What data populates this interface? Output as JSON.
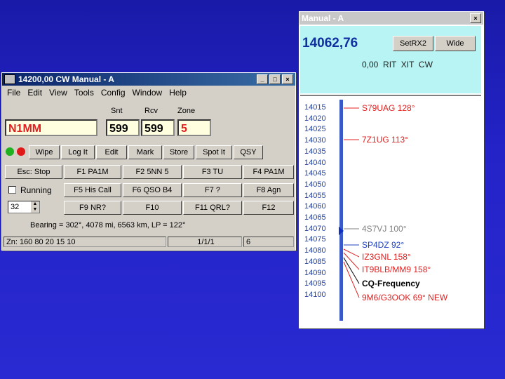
{
  "main": {
    "title": "14200,00 CW Manual - A",
    "window_controls": [
      "_",
      "□",
      "×"
    ],
    "menu": [
      "File",
      "Edit",
      "View",
      "Tools",
      "Config",
      "Window",
      "Help"
    ],
    "labels": {
      "snt": "Snt",
      "rcv": "Rcv",
      "zone": "Zone"
    },
    "callsign": "N1MM",
    "snt": "599",
    "rcv": "599",
    "zone": "5",
    "action_buttons": [
      "Wipe",
      "Log It",
      "Edit",
      "Mark",
      "Store",
      "Spot It",
      "QSY"
    ],
    "fkeys": [
      "Esc: Stop",
      "F1 PA1M",
      "F2 5NN 5",
      "F3 TU",
      "F4 PA1M",
      "F5 His Call",
      "F6 QSO B4",
      "F7 ?",
      "F8 Agn",
      "F9 NR?",
      "F10",
      "F11 QRL?",
      "F12"
    ],
    "running_label": "Running",
    "spin_value": "32",
    "bearing": "Bearing = 302°, 4078 mi, 6563 km, LP = 122°",
    "status": [
      "Zn: 160 80 20 15 10",
      "1/1/1",
      "6"
    ]
  },
  "bandmap": {
    "title": "Manual - A",
    "close": "×",
    "frequency": "14062,76",
    "buttons": [
      "SetRX2",
      "Wide"
    ],
    "indicators": "0,00  RIT  XIT  CW",
    "scale": [
      "14015",
      "14020",
      "14025",
      "14030",
      "14035",
      "14040",
      "14045",
      "14050",
      "14055",
      "14060",
      "14065",
      "14070",
      "14075",
      "14080",
      "14085",
      "14090",
      "14095",
      "14100"
    ],
    "spots": [
      {
        "text": "S79UAG 128°",
        "color": "#e02020"
      },
      {
        "text": "7Z1UG 113°",
        "color": "#e02020"
      },
      {
        "text": "4S7VJ 100°",
        "color": "#808080"
      },
      {
        "text": "SP4DZ 92°",
        "color": "#2040c0"
      },
      {
        "text": "IZ3GNL 158°",
        "color": "#e02020"
      },
      {
        "text": "IT9BLB/MM9 158°",
        "color": "#e02020"
      },
      {
        "text": "CQ-Frequency",
        "color": "#000000"
      },
      {
        "text": "9M6/G3OOK 69° NEW",
        "color": "#e02020"
      }
    ]
  }
}
